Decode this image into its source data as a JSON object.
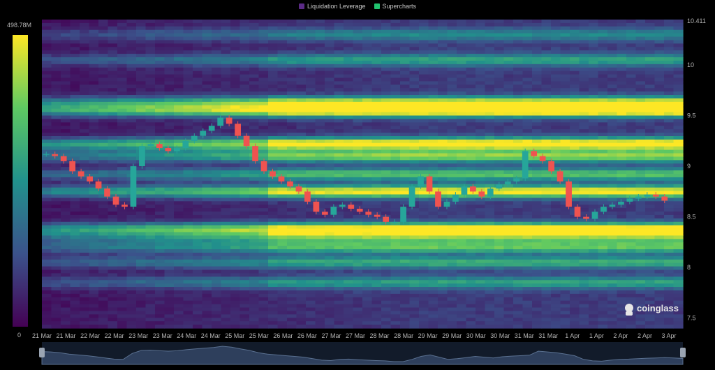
{
  "legend": {
    "items": [
      {
        "label": "Liquidation Leverage",
        "color": "#5b2a86"
      },
      {
        "label": "Supercharts",
        "color": "#21c36f"
      }
    ]
  },
  "colorbar": {
    "max_label": "498.78M",
    "min_label": "0",
    "colors": [
      "#440154",
      "#3b528b",
      "#21918c",
      "#5ec962",
      "#fde725"
    ]
  },
  "watermark": {
    "text": "coinglass"
  },
  "chart_data": {
    "type": "heatmap",
    "title": "",
    "ylim": [
      7.4,
      10.45
    ],
    "y_ticks": [
      7.5,
      8,
      8.5,
      9,
      9.5,
      10
    ],
    "y_tick_labels": [
      "7.5",
      "8",
      "8.5",
      "9",
      "9.5",
      "10"
    ],
    "y_top_label": "10.411",
    "x_tick_labels": [
      "21 Mar",
      "21 Mar",
      "22 Mar",
      "22 Mar",
      "23 Mar",
      "23 Mar",
      "24 Mar",
      "24 Mar",
      "25 Mar",
      "25 Mar",
      "26 Mar",
      "26 Mar",
      "27 Mar",
      "27 Mar",
      "28 Mar",
      "28 Mar",
      "29 Mar",
      "29 Mar",
      "30 Mar",
      "30 Mar",
      "31 Mar",
      "31 Mar",
      "1 Apr",
      "1 Apr",
      "2 Apr",
      "2 Apr",
      "3 Apr"
    ],
    "price_series": {
      "name": "",
      "color_up": "#26a69a",
      "color_down": "#ef5350",
      "values": [
        9.12,
        9.1,
        9.05,
        8.95,
        8.9,
        8.85,
        8.78,
        8.7,
        8.62,
        8.6,
        9.0,
        9.2,
        9.22,
        9.18,
        9.15,
        9.18,
        9.25,
        9.3,
        9.35,
        9.4,
        9.48,
        9.42,
        9.3,
        9.2,
        9.05,
        8.95,
        8.9,
        8.85,
        8.8,
        8.75,
        8.65,
        8.55,
        8.52,
        8.6,
        8.62,
        8.58,
        8.55,
        8.52,
        8.5,
        8.45,
        8.45,
        8.6,
        8.8,
        8.9,
        8.75,
        8.6,
        8.65,
        8.72,
        8.8,
        8.75,
        8.7,
        8.78,
        8.82,
        8.85,
        8.88,
        9.15,
        9.1,
        9.05,
        8.95,
        8.85,
        8.6,
        8.5,
        8.48,
        8.55,
        8.6,
        8.62,
        8.65,
        8.68,
        8.7,
        8.72,
        8.7,
        8.66
      ]
    },
    "liquidation_bands": [
      {
        "price": 9.55,
        "intensity": 1.0
      },
      {
        "price": 9.63,
        "intensity": 0.75
      },
      {
        "price": 9.22,
        "intensity": 0.95
      },
      {
        "price": 9.1,
        "intensity": 0.65
      },
      {
        "price": 8.92,
        "intensity": 0.55
      },
      {
        "price": 8.75,
        "intensity": 0.85
      },
      {
        "price": 8.38,
        "intensity": 0.9
      },
      {
        "price": 8.3,
        "intensity": 0.5
      },
      {
        "price": 8.2,
        "intensity": 0.55
      },
      {
        "price": 8.05,
        "intensity": 0.45
      },
      {
        "price": 7.85,
        "intensity": 0.4
      },
      {
        "price": 10.05,
        "intensity": 0.4
      },
      {
        "price": 10.3,
        "intensity": 0.3
      }
    ],
    "grid": false,
    "legend_position": "top-center"
  }
}
